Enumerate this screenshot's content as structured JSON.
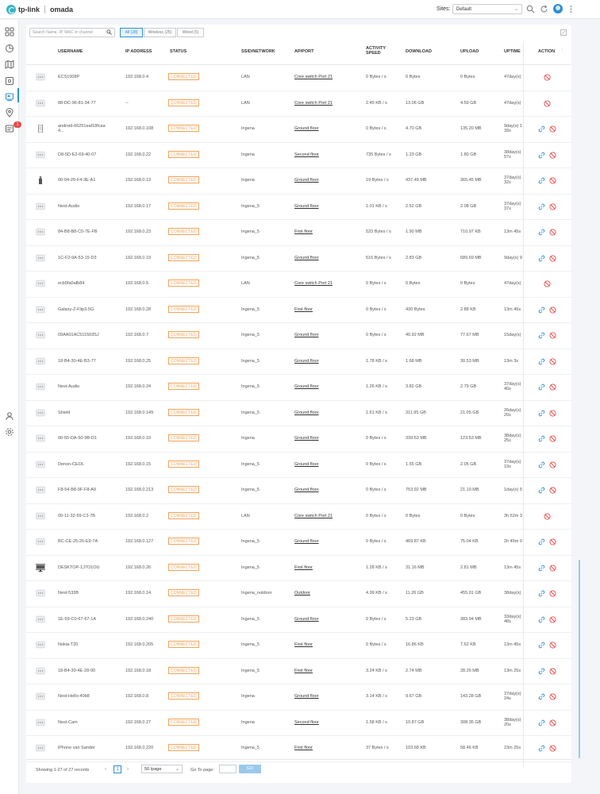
{
  "header": {
    "logo_tp": "tp-link",
    "logo_omada": "omada",
    "sites_label": "Sites:",
    "site_selected": "Default"
  },
  "nav": {
    "badge_count": "1"
  },
  "toolbar": {
    "search_placeholder": "Search Name, IP, MAC or channel",
    "filters": [
      "All (28)",
      "Wireless (25)",
      "Wired (5)"
    ]
  },
  "columns": [
    "USERNAME",
    "IP ADDRESS",
    "STATUS",
    "SSID/NETWORK",
    "AP/PORT",
    "ACTIVITY SPEED",
    "DOWNLOAD",
    "UPLOAD",
    "UPTIME",
    "ACTION"
  ],
  "rows": [
    {
      "icon": "generic-device",
      "username": "ECS1008P",
      "ip": "192.168.0.4",
      "status": "CONNECTED",
      "ssid": "LAN",
      "ap": "Core switch Port 21",
      "speed": "0 Bytes / s",
      "download": "0 Bytes",
      "upload": "0 Bytes",
      "uptime": "47day(s)",
      "link": false
    },
    {
      "icon": "generic-device",
      "username": "88-DC-96-81-34-77",
      "ip": "--",
      "status": "CONNECTED",
      "ssid": "LAN",
      "ap": "Core switch Port 21",
      "speed": "2.45 KB / s",
      "download": "13.06 GB",
      "upload": "4.59 GB",
      "uptime": "47day(s)",
      "link": false
    },
    {
      "icon": "phone",
      "username": "android-66251eaf18fcaa4...",
      "ip": "192.168.0.108",
      "status": "CONNECTED",
      "ssid": "Ingena",
      "ap": "Ground floor",
      "speed": "0 Bytes / s",
      "download": "4.70 GB",
      "upload": "135.20 MB",
      "uptime": "9day(s) 1 39s",
      "link": true
    },
    {
      "icon": "generic-device",
      "username": "D8-5D-E2-69-40-07",
      "ip": "192.168.0.22",
      "status": "CONNECTED",
      "ssid": "Ingena",
      "ap": "Second floor",
      "speed": "735 Bytes / s",
      "download": "1.23 GB",
      "upload": "1.80 GB",
      "uptime": "38day(s) 57s",
      "link": true
    },
    {
      "icon": "usb",
      "username": "00-04-20-F4-3E-A1",
      "ip": "192.168.0.13",
      "status": "CONNECTED",
      "ssid": "Ingena",
      "ap": "Ground floor",
      "speed": "19 Bytes / s",
      "download": "437.49 MB",
      "upload": "365.45 MB",
      "uptime": "37day(s) 32s",
      "link": true
    },
    {
      "icon": "generic-device",
      "username": "Nest-Audio",
      "ip": "192.168.0.17",
      "status": "CONNECTED",
      "ssid": "Ingena_5",
      "ap": "Ground floor",
      "speed": "1.01 KB / s",
      "download": "2.52 GB",
      "upload": "2.08 GB",
      "uptime": "37day(s) 37s",
      "link": true
    },
    {
      "icon": "generic-device",
      "username": "84-B8-B8-C0-7E-FB",
      "ip": "192.168.0.23",
      "status": "CONNECTED",
      "ssid": "Ingena_5",
      "ap": "First floor",
      "speed": "533 Bytes / s",
      "download": "1.90 MB",
      "upload": "710.97 KB",
      "uptime": "13m 45s",
      "link": true
    },
    {
      "icon": "generic-device",
      "username": "1C-F2-9A-53-15-D3",
      "ip": "192.168.0.19",
      "status": "CONNECTED",
      "ssid": "Ingena_5",
      "ap": "Ground floor",
      "speed": "516 Bytes / s",
      "download": "2.83 GB",
      "upload": "689.69 MB",
      "uptime": "9day(s) 9",
      "link": true
    },
    {
      "icon": "generic-device",
      "username": "ecb5fa0afb84",
      "ip": "192.168.0.5",
      "status": "CONNECTED",
      "ssid": "LAN",
      "ap": "Core switch Port 21",
      "speed": "0 Bytes / s",
      "download": "0 Bytes",
      "upload": "0 Bytes",
      "uptime": "47day(s)",
      "link": false
    },
    {
      "icon": "generic-device",
      "username": "Galaxy-Z-Flip3-5G",
      "ip": "192.168.0.28",
      "status": "CONNECTED",
      "ssid": "Ingena_5",
      "ap": "First floor",
      "speed": "0 Bytes / s",
      "download": "430 Bytes",
      "upload": "2.88 KB",
      "uptime": "13m 45s",
      "link": true
    },
    {
      "icon": "generic-device",
      "username": "09AA01AC511503SJ",
      "ip": "192.168.0.7",
      "status": "CONNECTED",
      "ssid": "Ingena_5",
      "ap": "Ground floor",
      "speed": "0 Bytes / s",
      "download": "40.92 MB",
      "upload": "77.67 MB",
      "uptime": "15day(s)",
      "link": true
    },
    {
      "icon": "generic-device",
      "username": "18-B4-30-4E-B3-77",
      "ip": "192.168.0.25",
      "status": "CONNECTED",
      "ssid": "Ingena_5",
      "ap": "Ground floor",
      "speed": "1.78 KB / s",
      "download": "1.68 MB",
      "upload": "30.53 MB",
      "uptime": "13m 3s",
      "link": true
    },
    {
      "icon": "generic-device",
      "username": "Nest-Audio",
      "ip": "192.168.0.24",
      "status": "CONNECTED",
      "ssid": "Ingena_5",
      "ap": "Ground floor",
      "speed": "1.26 KB / s",
      "download": "3.82 GB",
      "upload": "2.79 GB",
      "uptime": "37day(s) 40s",
      "link": true
    },
    {
      "icon": "generic-device",
      "username": "Shield",
      "ip": "192.168.0.149",
      "status": "CONNECTED",
      "ssid": "Ingena_5",
      "ap": "Ground floor",
      "speed": "1.61 KB / s",
      "download": "311.95 GB",
      "upload": "21.05 GB",
      "uptime": "26day(s) 20s",
      "link": true
    },
    {
      "icon": "generic-device",
      "username": "00-55-DA-50-9B-D1",
      "ip": "192.168.0.10",
      "status": "CONNECTED",
      "ssid": "Ingena",
      "ap": "Ground floor",
      "speed": "0 Bytes / s",
      "download": "339.53 MB",
      "upload": "123.53 MB",
      "uptime": "38day(s) 25s",
      "link": true
    },
    {
      "icon": "generic-device",
      "username": "Denon-CEOL",
      "ip": "192.168.0.15",
      "status": "CONNECTED",
      "ssid": "Ingena_5",
      "ap": "Ground floor",
      "speed": "0 Bytes / s",
      "download": "1.55 GB",
      "upload": "2.05 GB",
      "uptime": "37day(s) 19s",
      "link": true
    },
    {
      "icon": "generic-device",
      "username": "F8-54-B8-9F-F8-A9",
      "ip": "192.168.0.213",
      "status": "CONNECTED",
      "ssid": "Ingena_5",
      "ap": "Ground floor",
      "speed": "0 Bytes / s",
      "download": "753.92 MB",
      "upload": "21.19 MB",
      "uptime": "1day(s) 5",
      "link": true
    },
    {
      "icon": "generic-device",
      "username": "00-11-32-59-C3-7B",
      "ip": "192.168.0.2",
      "status": "CONNECTED",
      "ssid": "LAN",
      "ap": "Core switch Port 21",
      "speed": "0 Bytes / s",
      "download": "0 Bytes",
      "upload": "0 Bytes",
      "uptime": "3h 52m 3",
      "link": false
    },
    {
      "icon": "generic-device",
      "username": "BC-CE-25-26-E9-7A",
      "ip": "192.168.0.127",
      "status": "CONNECTED",
      "ssid": "Ingena_5",
      "ap": "Ground floor",
      "speed": "0 Bytes / s",
      "download": "469.87 KB",
      "upload": "75.04 KB",
      "uptime": "2h 45m 0",
      "link": true
    },
    {
      "icon": "monitor",
      "username": "DESKTOP-1J7O1OU",
      "ip": "192.168.0.26",
      "status": "CONNECTED",
      "ssid": "Ingena_5",
      "ap": "First floor",
      "speed": "1.28 KB / s",
      "download": "31.16 MB",
      "upload": "2.81 MB",
      "uptime": "13m 45s",
      "link": true
    },
    {
      "icon": "generic-device",
      "username": "Nest-533B",
      "ip": "192.168.0.14",
      "status": "CONNECTED",
      "ssid": "Ingena_outdoor",
      "ap": "Outdoor",
      "speed": "4.99 KB / s",
      "download": "11.26 GB",
      "upload": "455.01 GB",
      "uptime": "38day(s)",
      "link": true
    },
    {
      "icon": "generic-device",
      "username": "1E-59-C0-67-67-1A",
      "ip": "192.168.0.240",
      "status": "CONNECTED",
      "ssid": "Ingena_5",
      "ap": "Ground floor",
      "speed": "0 Bytes / s",
      "download": "5.23 GB",
      "upload": "383.94 MB",
      "uptime": "33day(s) 48s",
      "link": true
    },
    {
      "icon": "generic-device",
      "username": "Nokia-T20",
      "ip": "192.168.0.205",
      "status": "CONNECTED",
      "ssid": "Ingena_5",
      "ap": "First floor",
      "speed": "0 Bytes / s",
      "download": "16.86 KB",
      "upload": "7.62 KB",
      "uptime": "13m 45s",
      "link": true
    },
    {
      "icon": "generic-device",
      "username": "18-B4-30-4E-28-90",
      "ip": "192.168.0.18",
      "status": "CONNECTED",
      "ssid": "Ingena_5",
      "ap": "First floor",
      "speed": "3.24 KB / s",
      "download": "2.74 MB",
      "upload": "28.26 MB",
      "uptime": "13m 25s",
      "link": true
    },
    {
      "icon": "generic-device",
      "username": "Nest-Hello-40b8",
      "ip": "192.168.0.8",
      "status": "CONNECTED",
      "ssid": "Ingena",
      "ap": "Ground floor",
      "speed": "3.14 KB / s",
      "download": "9.67 GB",
      "upload": "143.28 GB",
      "uptime": "37day(s) 24s",
      "link": true
    },
    {
      "icon": "generic-device",
      "username": "Nest-Cam",
      "ip": "192.168.0.27",
      "status": "CONNECTED",
      "ssid": "Ingena",
      "ap": "Second floor",
      "speed": "1.58 KB / s",
      "download": "10.87 GB",
      "upload": "308.35 GB",
      "uptime": "38day(s) 20s",
      "link": true
    },
    {
      "icon": "generic-device",
      "username": "iPhone van Sander",
      "ip": "192.168.0.220",
      "status": "CONNECTED",
      "ssid": "Ingena_5",
      "ap": "First floor",
      "speed": "37 Bytes / s",
      "download": "103.68 KB",
      "upload": "58.46 KB",
      "uptime": "23m 25s",
      "link": true
    }
  ],
  "footer": {
    "showing": "Showing 1-27 of 27 records",
    "page": "1",
    "per_page": "50 /page",
    "goto_label": "Go To page:",
    "go_label": "GO"
  },
  "colors": {
    "accent": "#2d8fd6",
    "status": "#f0a35a",
    "block": "#e84a4a"
  }
}
